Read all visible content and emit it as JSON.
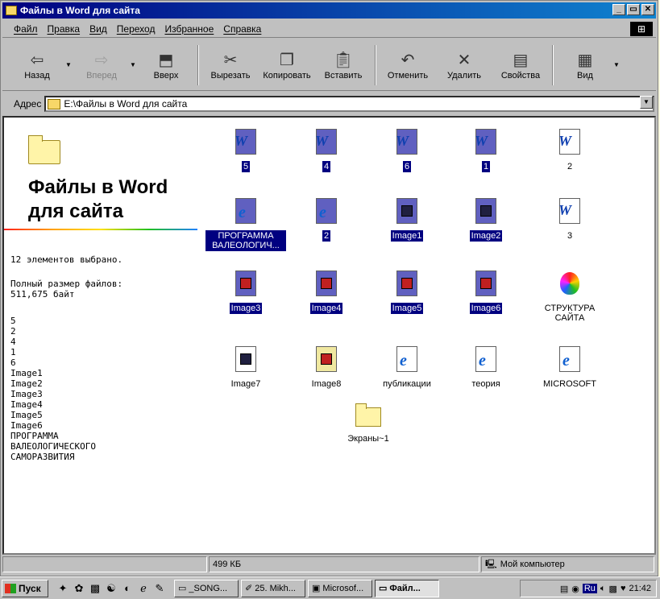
{
  "window": {
    "title": "Файлы в Word для сайта",
    "controls": [
      "_",
      "▭",
      "✕"
    ]
  },
  "menu": [
    "Файл",
    "Правка",
    "Вид",
    "Переход",
    "Избранное",
    "Справка"
  ],
  "toolbar": {
    "back": "Назад",
    "forward": "Вперед",
    "up": "Вверх",
    "cut": "Вырезать",
    "copy": "Копировать",
    "paste": "Вставить",
    "undo": "Отменить",
    "delete": "Удалить",
    "properties": "Свойства",
    "view": "Вид"
  },
  "address": {
    "label": "Адрес",
    "value": "E:\\Файлы в Word для сайта"
  },
  "left_panel": {
    "title": "Файлы в Word для сайта",
    "selected": "12 элементов выбрано.",
    "size_label": "Полный размер файлов:",
    "size_value": "511,675 байт",
    "list": "5\n2\n4\n1\n6\nImage1\nImage2\nImage3\nImage4\nImage5\nImage6\nПРОГРАММА\nВАЛЕОЛОГИЧЕСКОГО\nСАМОРАЗВИТИЯ"
  },
  "files": [
    {
      "label": "5",
      "type": "word",
      "selected": true
    },
    {
      "label": "4",
      "type": "word",
      "selected": true
    },
    {
      "label": "6",
      "type": "word",
      "selected": true
    },
    {
      "label": "1",
      "type": "word",
      "selected": true
    },
    {
      "label": "2",
      "type": "word",
      "selected": false
    },
    {
      "label": "ПРОГРАММА ВАЛЕОЛОГИЧ...",
      "type": "html",
      "selected": true
    },
    {
      "label": "2",
      "type": "html",
      "selected": true
    },
    {
      "label": "Image1",
      "type": "image",
      "selected": true
    },
    {
      "label": "Image2",
      "type": "image",
      "selected": true
    },
    {
      "label": "3",
      "type": "word",
      "selected": false
    },
    {
      "label": "Image3",
      "type": "paint",
      "selected": true
    },
    {
      "label": "Image4",
      "type": "paint",
      "selected": true
    },
    {
      "label": "Image5",
      "type": "paint",
      "selected": true
    },
    {
      "label": "Image6",
      "type": "paint",
      "selected": true
    },
    {
      "label": "СТРУКТУРА САЙТА",
      "type": "balloon",
      "selected": false
    },
    {
      "label": "Image7",
      "type": "image",
      "selected": false
    },
    {
      "label": "Image8",
      "type": "paint",
      "selected": false
    },
    {
      "label": "публикации",
      "type": "html",
      "selected": false
    },
    {
      "label": "теория",
      "type": "html",
      "selected": false
    },
    {
      "label": "MICROSOFT",
      "type": "html",
      "selected": false
    },
    {
      "label": "Экраны~1",
      "type": "folder",
      "selected": false
    }
  ],
  "status": {
    "size": "499 КБ",
    "location": "Мой компьютер"
  },
  "taskbar": {
    "start": "Пуск",
    "tasks": [
      "_SONG...",
      "25. Mikh...",
      "Microsof...",
      "Файл..."
    ],
    "lang": "Ru",
    "time": "21:42"
  }
}
